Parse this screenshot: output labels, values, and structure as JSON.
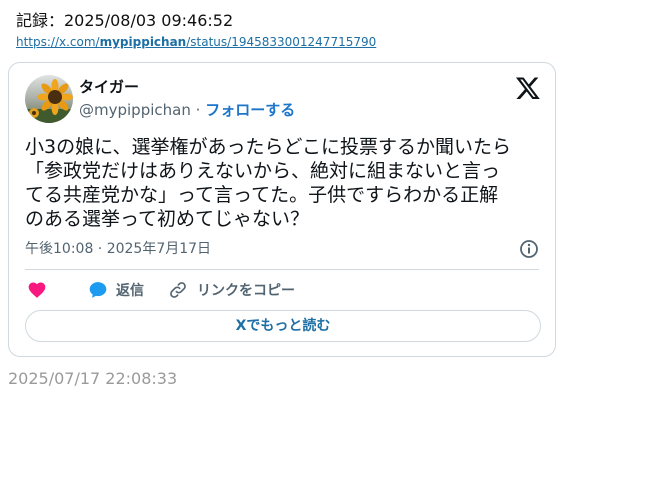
{
  "record": {
    "text": "記録：2025/08/03 09:46:52"
  },
  "source_url": {
    "prefix": "https://x.com/",
    "user": "mypippichan",
    "suffix": "/status/1945833001247715790"
  },
  "tweet": {
    "display_name": "タイガー",
    "handle": "@mypippichan",
    "separator": "·",
    "follow_label": "フォローする",
    "text_lines": [
      "小3の娘に、選挙権があったらどこに投票するか聞いたら",
      "「参政党だけはありえないから、絶対に組まないと言っ",
      "てる共産党かな」って言ってた。子供ですらわかる正解",
      "のある選挙って初めてじゃない？"
    ],
    "timestamp": "午後10:08 · 2025年7月17日",
    "reply_label": "返信",
    "copy_link_label": "リンクをコピー",
    "read_more_label": "Xでもっと読む"
  },
  "archived_time": "2025/07/17 22:08:33",
  "colors": {
    "like": "#f91880",
    "reply": "#1d9bf0",
    "link": "#1d6fa5",
    "border": "#cfd9de"
  },
  "icons": [
    "x-logo-icon",
    "info-icon",
    "heart-icon",
    "reply-bubble-icon",
    "link-icon",
    "sunflower-avatar"
  ]
}
